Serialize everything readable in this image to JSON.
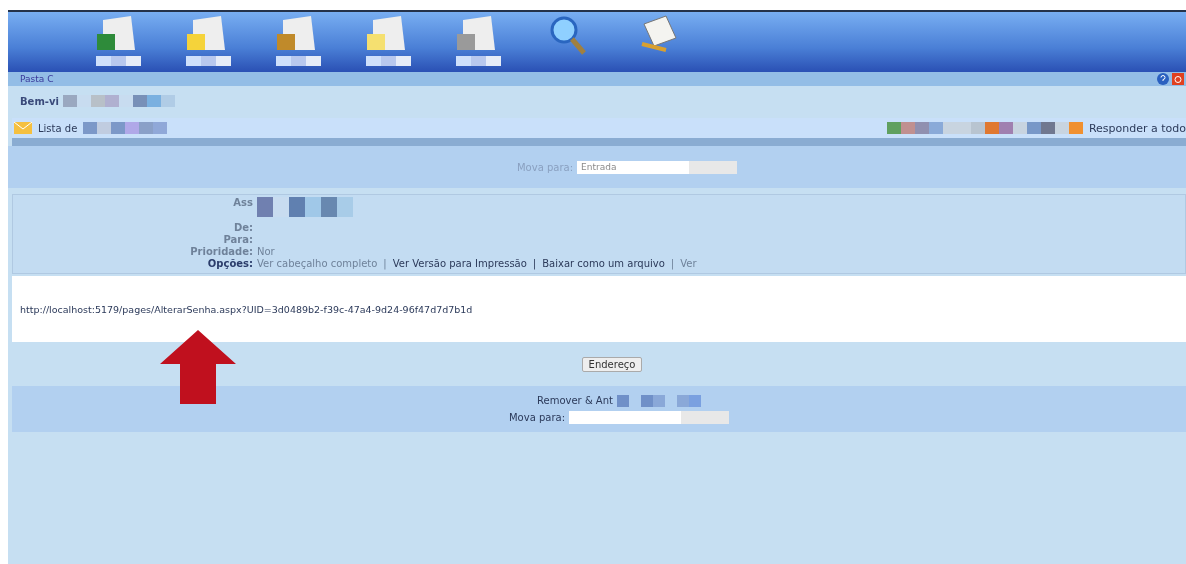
{
  "folder_bar": {
    "label": "Pasta C"
  },
  "welcome": {
    "label": "Bem-vi"
  },
  "message_bar": {
    "title": "Lista de",
    "action": "Responder a todo"
  },
  "move_top": {
    "label": "Mova para:",
    "placeholder": "Entrada"
  },
  "header": {
    "subject_label": "Ass",
    "fields": [
      {
        "label": "De:"
      },
      {
        "label": "Para:"
      },
      {
        "label": "Prioridade:",
        "value": "Nor"
      }
    ],
    "options": {
      "label": "Opções:",
      "links": [
        {
          "text": "Ver cabeçalho completo",
          "faded": true
        },
        {
          "text": "|",
          "faded": true
        },
        {
          "text": "Ver Versão para Impressão",
          "faded": false
        },
        {
          "text": "|",
          "faded": false
        },
        {
          "text": "Baixar como um arquivo",
          "faded": false
        },
        {
          "text": "|",
          "faded": true
        },
        {
          "text": "Ver",
          "faded": true
        }
      ]
    }
  },
  "body": {
    "text": "http://localhost:5179/pages/AlterarSenha.aspx?UID=3d0489b2-f39c-47a4-9d24-96f47d7d7b1d"
  },
  "address_button": {
    "label": "Endereço"
  },
  "bottom": {
    "action": "Remover & Ant",
    "move_label": "Mova para:"
  },
  "annotation": {
    "kind": "arrow"
  }
}
